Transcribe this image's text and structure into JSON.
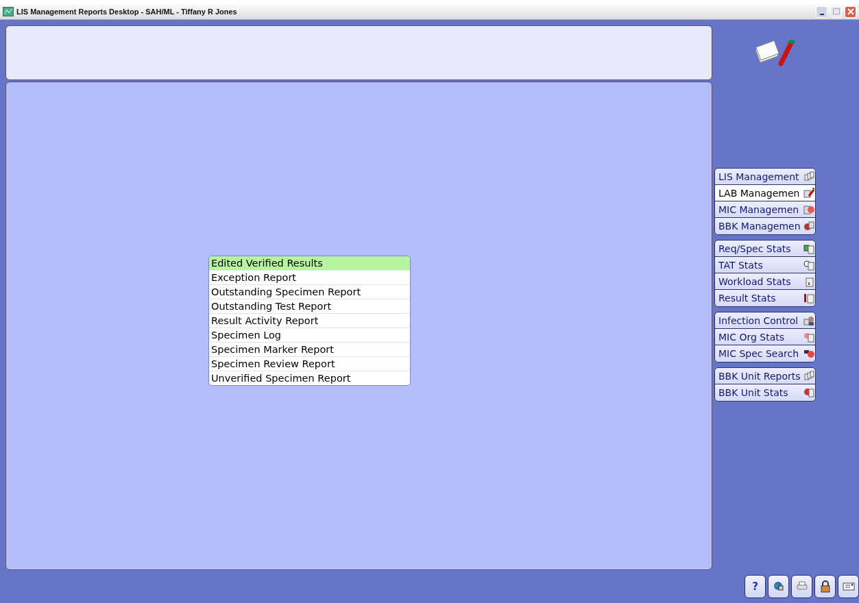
{
  "window": {
    "title": "LIS Management Reports Desktop - SAH/ML - Tiffany R Jones"
  },
  "sidebar": {
    "groups": [
      {
        "items": [
          {
            "label": "LIS Management",
            "selected": false
          },
          {
            "label": "LAB Managemen",
            "selected": true
          },
          {
            "label": "MIC Managemen",
            "selected": false
          },
          {
            "label": "BBK Managemen",
            "selected": false
          }
        ]
      },
      {
        "items": [
          {
            "label": "Req/Spec Stats",
            "selected": false
          },
          {
            "label": "TAT Stats",
            "selected": false
          },
          {
            "label": "Workload Stats",
            "selected": false
          },
          {
            "label": "Result Stats",
            "selected": false
          }
        ]
      },
      {
        "items": [
          {
            "label": "Infection Control",
            "selected": false
          },
          {
            "label": "MIC Org Stats",
            "selected": false
          },
          {
            "label": "MIC Spec Search",
            "selected": false
          }
        ]
      },
      {
        "items": [
          {
            "label": "BBK Unit Reports",
            "selected": false
          },
          {
            "label": "BBK Unit Stats",
            "selected": false
          }
        ]
      }
    ]
  },
  "report_list": {
    "items": [
      {
        "label": "Edited Verified Results",
        "selected": true
      },
      {
        "label": "Exception Report",
        "selected": false
      },
      {
        "label": "Outstanding Specimen Report",
        "selected": false
      },
      {
        "label": "Outstanding Test Report",
        "selected": false
      },
      {
        "label": "Result Activity Report",
        "selected": false
      },
      {
        "label": "Specimen Log",
        "selected": false
      },
      {
        "label": "Specimen Marker Report",
        "selected": false
      },
      {
        "label": "Specimen Review Report",
        "selected": false
      },
      {
        "label": "Unverified Specimen Report",
        "selected": false
      }
    ]
  },
  "toolbar": {
    "buttons": [
      {
        "kind": "help",
        "label": "?"
      },
      {
        "kind": "globe"
      },
      {
        "kind": "print"
      },
      {
        "kind": "lock"
      },
      {
        "kind": "message"
      }
    ]
  }
}
